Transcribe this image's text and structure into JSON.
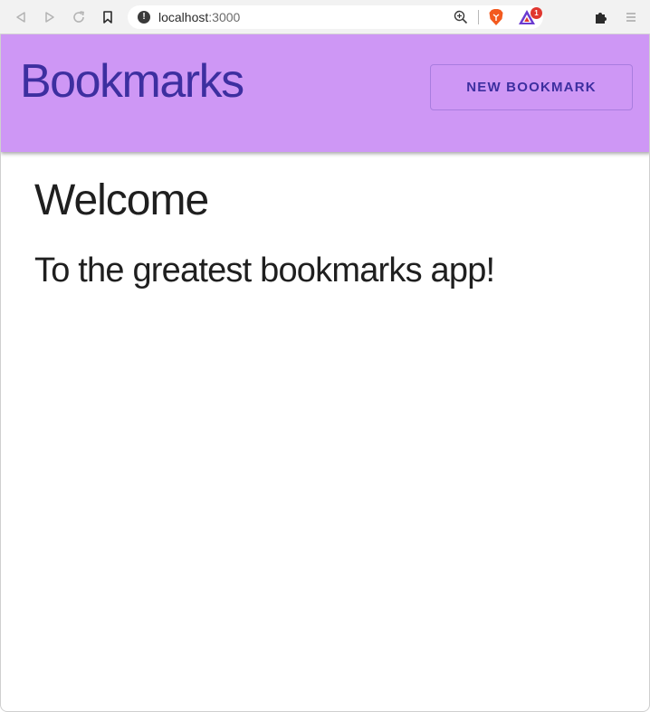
{
  "browser": {
    "url_host": "localhost",
    "url_port": ":3000",
    "rewards_badge": "1",
    "icons": [
      "back-icon",
      "forward-icon",
      "reload-icon",
      "bookmark-icon",
      "site-info-icon",
      "zoom-icon",
      "brave-shield-icon",
      "brave-rewards-icon",
      "extensions-icon",
      "menu-icon"
    ]
  },
  "header": {
    "brand": "Bookmarks",
    "new_bookmark_label": "NEW BOOKMARK",
    "background": "#ce97f5",
    "accent": "#3d2fa0"
  },
  "main": {
    "heading": "Welcome",
    "subheading": "To the greatest bookmarks app!"
  }
}
